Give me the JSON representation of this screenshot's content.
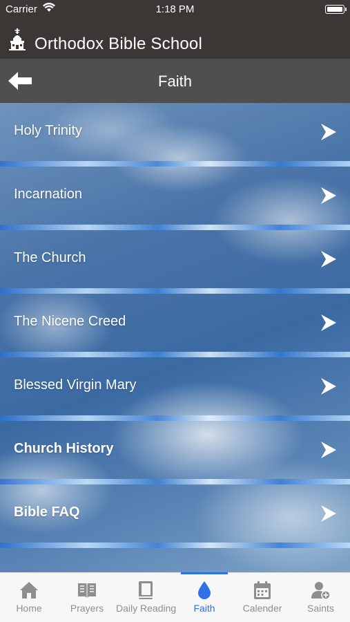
{
  "status_bar": {
    "carrier": "Carrier",
    "time": "1:18 PM"
  },
  "app_bar": {
    "title": "Orthodox Bible School",
    "logo_icon": "orthodox-cross-church-icon"
  },
  "sub_header": {
    "title": "Faith",
    "back_icon": "back-arrow-icon"
  },
  "menu": {
    "items": [
      {
        "label": "Holy Trinity",
        "bold": false
      },
      {
        "label": "Incarnation",
        "bold": false
      },
      {
        "label": "The Church",
        "bold": false
      },
      {
        "label": "The Nicene Creed",
        "bold": false
      },
      {
        "label": "Blessed Virgin Mary",
        "bold": false
      },
      {
        "label": "Church History",
        "bold": true
      },
      {
        "label": "Bible FAQ",
        "bold": true
      }
    ],
    "chevron_icon": "chevron-right-icon"
  },
  "tab_bar": {
    "active_color": "#2f6fe8",
    "inactive_color": "#8e8e8e",
    "tabs": [
      {
        "label": "Home",
        "icon": "home-icon"
      },
      {
        "label": "Prayers",
        "icon": "open-book-icon"
      },
      {
        "label": "Daily Reading",
        "icon": "bible-icon"
      },
      {
        "label": "Faith",
        "icon": "flame-drop-icon",
        "active": true
      },
      {
        "label": "Calender",
        "icon": "calendar-icon"
      },
      {
        "label": "Saints",
        "icon": "person-add-icon"
      }
    ]
  },
  "colors": {
    "header_bg": "#3b3734",
    "subheader_bg": "#4f4f4f"
  }
}
